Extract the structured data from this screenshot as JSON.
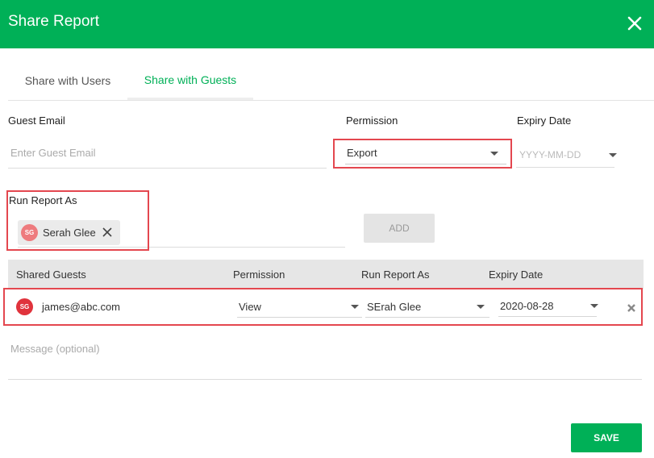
{
  "dialog": {
    "title": "Share Report"
  },
  "tabs": [
    {
      "label": "Share with Users",
      "active": false
    },
    {
      "label": "Share with Guests",
      "active": true
    }
  ],
  "form": {
    "guest_email_label": "Guest Email",
    "guest_email_placeholder": "Enter Guest Email",
    "permission_label": "Permission",
    "permission_value": "Export",
    "expiry_label": "Expiry Date",
    "expiry_placeholder": "YYYY-MM-DD",
    "run_as_label": "Run Report As",
    "run_as_chip": {
      "initials": "SG",
      "name": "Serah Glee"
    },
    "add_label": "ADD"
  },
  "table": {
    "headers": [
      "Shared Guests",
      "Permission",
      "Run Report As",
      "Expiry Date"
    ],
    "rows": [
      {
        "initials": "SG",
        "email": "james@abc.com",
        "permission": "View",
        "run_as": "SErah Glee",
        "expiry": "2020-08-28"
      }
    ]
  },
  "message_placeholder": "Message (optional)",
  "save_label": "SAVE",
  "colors": {
    "brand_green": "#00b057",
    "highlight_red": "#e4474f",
    "chip_avatar": "#ee7b7e",
    "row_avatar": "#e0333c"
  },
  "icons": {
    "close": "close-icon",
    "chip_remove": "remove-chip-icon",
    "row_delete": "delete-row-icon",
    "dropdown": "chevron-down-icon"
  }
}
